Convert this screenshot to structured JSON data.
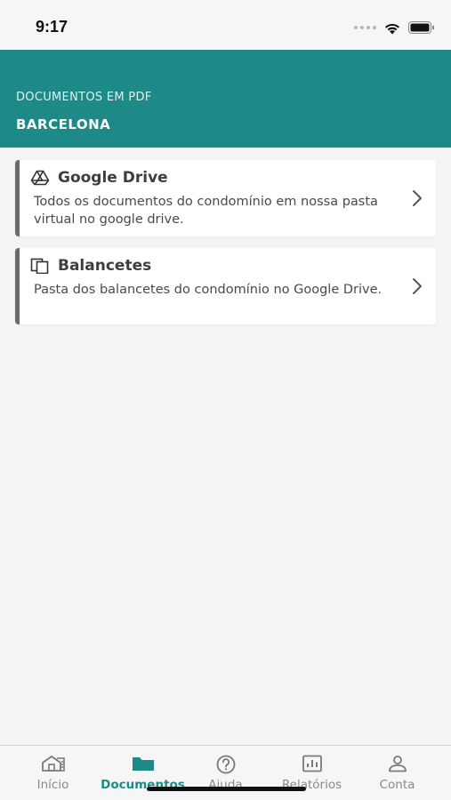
{
  "status_bar": {
    "time": "9:17"
  },
  "header": {
    "subtitle": "DOCUMENTOS EM PDF",
    "title": "BARCELONA",
    "background_color": "#1e8a87"
  },
  "cards": [
    {
      "icon": "google-drive-icon",
      "title": "Google Drive",
      "description": "Todos os documentos do condomínio em nossa pasta virtual no google drive."
    },
    {
      "icon": "copy-documents-icon",
      "title": "Balancetes",
      "description": "Pasta dos balancetes do condomínio no Google Drive."
    }
  ],
  "tab_bar": {
    "active_color": "#1e8a87",
    "tabs": [
      {
        "label": "Início",
        "icon": "home-icon",
        "active": false
      },
      {
        "label": "Documentos",
        "icon": "folder-icon",
        "active": true
      },
      {
        "label": "Ajuda",
        "icon": "help-icon",
        "active": false
      },
      {
        "label": "Relatórios",
        "icon": "report-icon",
        "active": false
      },
      {
        "label": "Conta",
        "icon": "account-icon",
        "active": false
      }
    ]
  }
}
